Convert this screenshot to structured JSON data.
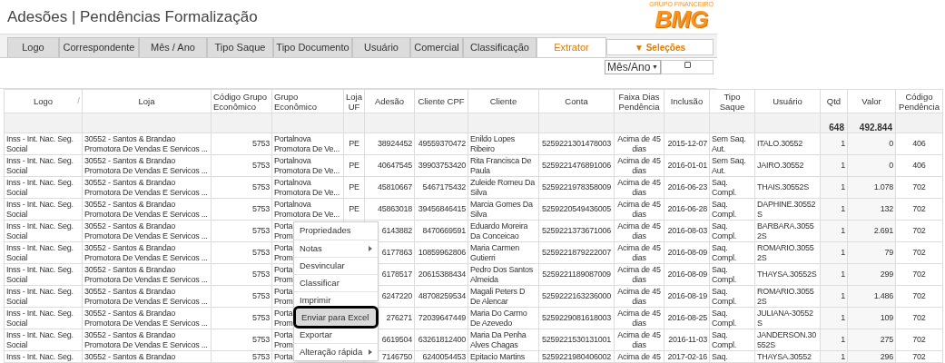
{
  "page_title": "Adesões | Pendências Formalização",
  "logo": {
    "tagline": "GRUPO FINANCEIRO",
    "name": "BMG"
  },
  "tabs": [
    {
      "label": "Logo",
      "selected": false
    },
    {
      "label": "Correspondente",
      "selected": false
    },
    {
      "label": "Mês / Ano",
      "selected": false
    },
    {
      "label": "Tipo Saque",
      "selected": false
    },
    {
      "label": "Tipo Documento",
      "selected": false
    },
    {
      "label": "Usuário",
      "selected": false
    },
    {
      "label": "Comercial",
      "selected": false
    },
    {
      "label": "Classificação",
      "selected": false
    },
    {
      "label": "Extrator",
      "selected": true
    }
  ],
  "selections_button": "▼ Seleções",
  "period_select": {
    "value": "Mês/Ano",
    "arrow": "▼"
  },
  "period_checkbox": {
    "checked": false
  },
  "table": {
    "columns": [
      {
        "label": "Logo",
        "mark": "/"
      },
      {
        "label": "Loja"
      },
      {
        "label": "Código Grupo Econômico"
      },
      {
        "label": "Grupo Econômico"
      },
      {
        "label": "Loja UF"
      },
      {
        "label": "Adesão"
      },
      {
        "label": "Cliente CPF"
      },
      {
        "label": "Cliente"
      },
      {
        "label": "Conta"
      },
      {
        "label": "Faixa Dias Pendência"
      },
      {
        "label": "Inclusão"
      },
      {
        "label": "Tipo Saque"
      },
      {
        "label": "Usuário"
      },
      {
        "label": "Qtd"
      },
      {
        "label": "Valor"
      },
      {
        "label": "Código Pendência"
      }
    ],
    "totals": {
      "qtd": "648",
      "valor": "492.844"
    },
    "rows": [
      [
        "Inss - Int. Nac. Seg. Social",
        "30552 - Santos & Brandao Promotora De Vendas E Servicos ...",
        "5753",
        "Portalnova Promotora De Ve...",
        "PE",
        "38924452",
        "49559370472",
        "Enildo Lopes Ribeiro",
        "5259221301478003",
        "Acima de 45 dias",
        "2015-12-07",
        "Sem Saq. Aut.",
        "ITALO.30552",
        "1",
        "0",
        "406"
      ],
      [
        "Inss - Int. Nac. Seg. Social",
        "30552 - Santos & Brandao Promotora De Vendas E Servicos ...",
        "5753",
        "Portalnova Promotora De Ve...",
        "PE",
        "40647545",
        "39903753420",
        "Rita Francisca De Paula",
        "5259221476891006",
        "Acima de 45 dias",
        "2016-01-01",
        "Sem Saq. Aut.",
        "JAIRO.30552",
        "1",
        "0",
        "406"
      ],
      [
        "Inss - Int. Nac. Seg. Social",
        "30552 - Santos & Brandao Promotora De Vendas E Servicos ...",
        "5753",
        "Portalnova Promotora De Ve...",
        "PE",
        "45810667",
        "5467175432",
        "Zuleide Romeu Da Silva",
        "5259221978358009",
        "Acima de 45 dias",
        "2016-06-23",
        "Saq. Compl.",
        "THAIS.30552S",
        "1",
        "1.078",
        "702"
      ],
      [
        "Inss - Int. Nac. Seg. Social",
        "30552 - Santos & Brandao Promotora De Vendas E Servicos ...",
        "5753",
        "Portalnova Promotora De Ve...",
        "PE",
        "45863018",
        "39456846415",
        "Marcia Gomes Da Silva",
        "5259220549436005",
        "Acima de 45 dias",
        "2016-06-28",
        "Saq. Compl.",
        "DAPHINE.30552S",
        "1",
        "132",
        "702"
      ],
      [
        "Inss - Int. Nac. Seg. Social",
        "30552 - Santos & Brandao Promotora De Vendas E Servicos ...",
        "5753",
        "Porta\nProm",
        null,
        "6143882",
        "8470669591",
        "Eduardo Moreira Da Conceicao",
        "5259221373671006",
        "Acima de 45 dias",
        "2016-08-03",
        "Saq. Compl.",
        "BARBARA.30552S",
        "1",
        "2.691",
        "702"
      ],
      [
        "Inss - Int. Nac. Seg. Social",
        "30552 - Santos & Brandao Promotora De Vendas E Servicos ...",
        "5753",
        "Porta\nProm",
        null,
        "6177863",
        "10859962806",
        "Maria Carmen Gutierri",
        "5259221879222007",
        "Acima de 45 dias",
        "2016-08-09",
        "Saq. Compl.",
        "ROMARIO.30552S",
        "1",
        "79",
        "702"
      ],
      [
        "Inss - Int. Nac. Seg. Social",
        "30552 - Santos & Brandao Promotora De Vendas E Servicos ...",
        "5753",
        "Porta\nProm",
        null,
        "6178517",
        "20615388434",
        "Pedro Dos Santos Almeida",
        "5259221189087009",
        "Acima de 45 dias",
        "2016-08-09",
        "Saq. Compl.",
        "THAYSA.30552S",
        "1",
        "299",
        "702"
      ],
      [
        "Inss - Int. Nac. Seg. Social",
        "30552 - Santos & Brandao Promotora De Vendas E Servicos ...",
        "5753",
        "Porta\nProm",
        null,
        "6247220",
        "48708259534",
        "Magali Peters D De Alencar",
        "5259222163236000",
        "Acima de 45 dias",
        "2016-08-19",
        "Saq. Compl.",
        "ROMARIO.30552S",
        "1",
        "1.486",
        "702"
      ],
      [
        "Inss - Int. Nac. Seg. Social",
        "30552 - Santos & Brandao Promotora De Vendas E Servicos ...",
        "5753",
        "Porta\nProm",
        null,
        "276271",
        "72039647449",
        "Maria Do Carmo De Azevedo",
        "5259229081618003",
        "Acima de 45 dias",
        "2016-08-25",
        "Saq. Compl.",
        "JULIANA-30552S",
        "1",
        "109",
        "702"
      ],
      [
        "Inss - Int. Nac. Seg. Social",
        "30552 - Santos & Brandao Promotora De Vendas E Servicos ...",
        "5753",
        "Porta\nProm",
        null,
        "6619504",
        "63261812400",
        "Maria Da Penha Alves Chagas",
        "5259221530131001",
        "Acima de 45 dias",
        "2016-11-03",
        "Saq. Compl.",
        "JANDERSON.30552S",
        "1",
        "275",
        "702"
      ],
      [
        "Inss - Int. Nac. Seg.",
        "30552 - Santos & Brandao",
        "5753",
        "Porta",
        null,
        "7146750",
        "6240054453",
        "Epitacio Martins",
        "5259221980406002",
        "Acima de 45",
        "2017-02-16",
        "Saq.",
        "THAYSA.30552",
        "1",
        "296",
        "702"
      ]
    ]
  },
  "context_menu": [
    {
      "label": "Propriedades",
      "submenu": false,
      "selected": false
    },
    {
      "label": "Notas",
      "submenu": true,
      "selected": false
    },
    {
      "label": "Desvincular",
      "submenu": false,
      "selected": false
    },
    {
      "label": "Classificar",
      "submenu": false,
      "selected": false
    },
    {
      "label": "Imprimir",
      "submenu": false,
      "selected": false
    },
    {
      "label": "Enviar para Excel",
      "submenu": false,
      "selected": true
    },
    {
      "label": "Exportar",
      "submenu": false,
      "selected": false
    },
    {
      "label": "Alteração rápida",
      "submenu": true,
      "selected": false
    }
  ]
}
